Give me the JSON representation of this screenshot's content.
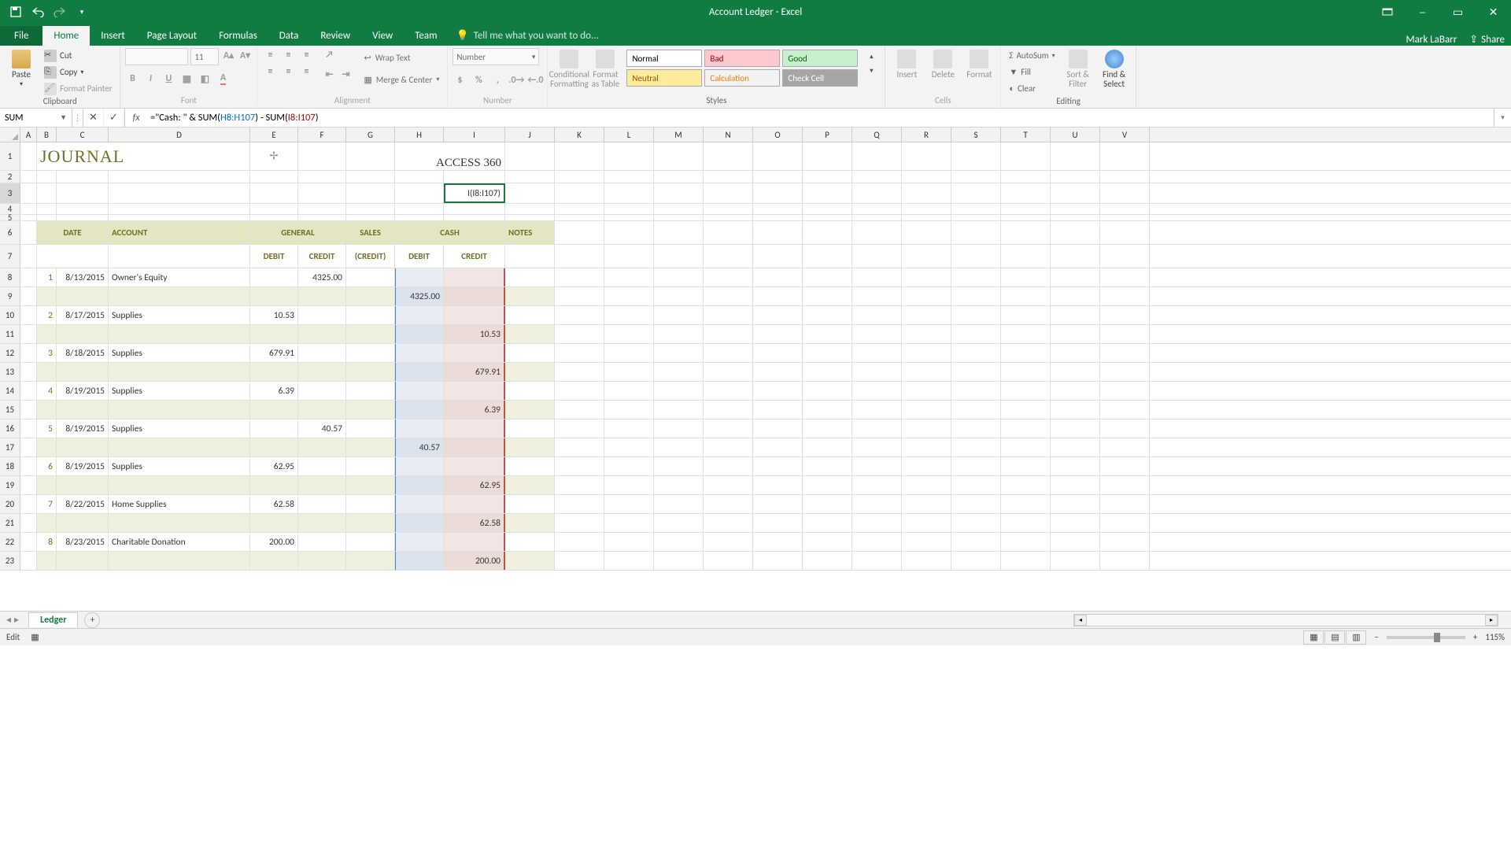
{
  "title_bar": {
    "title": "Account Ledger - Excel",
    "user": "Mark LaBarr",
    "share": "Share"
  },
  "tabs": {
    "file": "File",
    "items": [
      "Home",
      "Insert",
      "Page Layout",
      "Formulas",
      "Data",
      "Review",
      "View",
      "Team"
    ],
    "active": "Home",
    "tell_me": "Tell me what you want to do..."
  },
  "ribbon": {
    "paste": "Paste",
    "cut": "Cut",
    "copy": "Copy",
    "format_painter": "Format Painter",
    "group_clipboard": "Clipboard",
    "font_size": "11",
    "group_font": "Font",
    "wrap_text": "Wrap Text",
    "merge_center": "Merge & Center",
    "group_alignment": "Alignment",
    "number_format": "Number",
    "group_number": "Number",
    "cond_fmt": "Conditional Formatting",
    "fmt_table": "Format as Table",
    "style_normal": "Normal",
    "style_bad": "Bad",
    "style_good": "Good",
    "style_neutral": "Neutral",
    "style_calc": "Calculation",
    "style_check": "Check Cell",
    "group_styles": "Styles",
    "insert": "Insert",
    "delete": "Delete",
    "format": "Format",
    "group_cells": "Cells",
    "autosum": "AutoSum",
    "fill": "Fill",
    "clear": "Clear",
    "sort_filter": "Sort & Filter",
    "find_select": "Find & Select",
    "group_editing": "Editing"
  },
  "name_box": "SUM",
  "formula_bar": {
    "prefix": "=\"Cash: \" & SUM(",
    "ref1": "H8:H107",
    "mid": ") - SUM(",
    "ref2": "I8:I107",
    "suffix": ")"
  },
  "columns": [
    "A",
    "B",
    "C",
    "D",
    "E",
    "F",
    "G",
    "H",
    "I",
    "J",
    "K",
    "L",
    "M",
    "N",
    "O",
    "P",
    "Q",
    "R",
    "S",
    "T",
    "U",
    "V"
  ],
  "journal": {
    "title": "JOURNAL",
    "company": "ACCESS 360",
    "active_cell_display": "I(I8:I107)",
    "headers": {
      "date": "DATE",
      "account": "ACCOUNT",
      "general": "GENERAL",
      "sales": "SALES",
      "cash": "CASH",
      "notes": "NOTES"
    },
    "subheaders": {
      "debit": "DEBIT",
      "credit": "CREDIT",
      "sales_credit": "(CREDIT)"
    },
    "entries": [
      {
        "n": "1",
        "date": "8/13/2015",
        "account": "Owner's Equity",
        "gen_debit": "",
        "gen_credit": "4325.00",
        "sales": "",
        "cash_debit": "4325.00",
        "cash_credit": ""
      },
      {
        "n": "2",
        "date": "8/17/2015",
        "account": "Supplies",
        "gen_debit": "10.53",
        "gen_credit": "",
        "sales": "",
        "cash_debit": "",
        "cash_credit": "10.53"
      },
      {
        "n": "3",
        "date": "8/18/2015",
        "account": "Supplies",
        "gen_debit": "679.91",
        "gen_credit": "",
        "sales": "",
        "cash_debit": "",
        "cash_credit": "679.91"
      },
      {
        "n": "4",
        "date": "8/19/2015",
        "account": "Supplies",
        "gen_debit": "6.39",
        "gen_credit": "",
        "sales": "",
        "cash_debit": "",
        "cash_credit": "6.39"
      },
      {
        "n": "5",
        "date": "8/19/2015",
        "account": "Supplies",
        "gen_debit": "",
        "gen_credit": "40.57",
        "sales": "",
        "cash_debit": "40.57",
        "cash_credit": ""
      },
      {
        "n": "6",
        "date": "8/19/2015",
        "account": "Supplies",
        "gen_debit": "62.95",
        "gen_credit": "",
        "sales": "",
        "cash_debit": "",
        "cash_credit": "62.95"
      },
      {
        "n": "7",
        "date": "8/22/2015",
        "account": "Home Supplies",
        "gen_debit": "62.58",
        "gen_credit": "",
        "sales": "",
        "cash_debit": "",
        "cash_credit": "62.58"
      },
      {
        "n": "8",
        "date": "8/23/2015",
        "account": "Charitable Donation",
        "gen_debit": "200.00",
        "gen_credit": "",
        "sales": "",
        "cash_debit": "",
        "cash_credit": "200.00"
      }
    ]
  },
  "sheet_tabs": {
    "active": "Ledger"
  },
  "status_bar": {
    "mode": "Edit",
    "zoom": "115%"
  }
}
